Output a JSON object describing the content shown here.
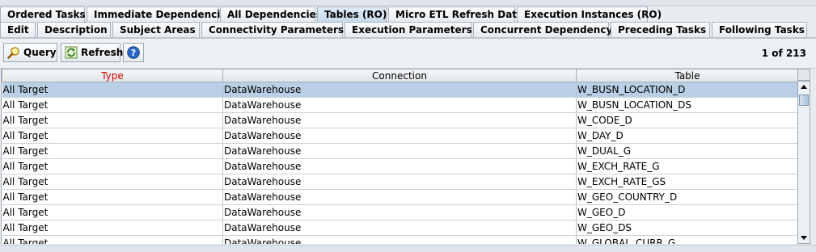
{
  "tabs_row1": [
    {
      "label": "Ordered Tasks",
      "active": false
    },
    {
      "label": "Immediate Dependencies",
      "active": false
    },
    {
      "label": "All Dependencies",
      "active": false
    },
    {
      "label": "Tables (RO)",
      "active": true
    },
    {
      "label": "Micro ETL Refresh Dates",
      "active": false
    },
    {
      "label": "Execution Instances (RO)",
      "active": false
    }
  ],
  "tabs_row2": [
    {
      "label": "Edit"
    },
    {
      "label": "Description"
    },
    {
      "label": "Subject Areas"
    },
    {
      "label": "Connectivity Parameters"
    },
    {
      "label": "Execution Parameters"
    },
    {
      "label": "Concurrent Dependency"
    },
    {
      "label": "Preceding Tasks"
    },
    {
      "label": "Following Tasks"
    }
  ],
  "toolbar": {
    "query_label": "Query",
    "refresh_label": "Refresh",
    "help_icon": "help-icon",
    "pager": "1 of 213"
  },
  "colors": {
    "selected_row": "#b8cfe5",
    "type_header": "#d40000",
    "active_tab": "#c8daee"
  },
  "table": {
    "columns": [
      "Type",
      "Connection",
      "Table"
    ],
    "rows": [
      [
        "All Target",
        "DataWarehouse",
        "W_BUSN_LOCATION_D"
      ],
      [
        "All Target",
        "DataWarehouse",
        "W_BUSN_LOCATION_DS"
      ],
      [
        "All Target",
        "DataWarehouse",
        "W_CODE_D"
      ],
      [
        "All Target",
        "DataWarehouse",
        "W_DAY_D"
      ],
      [
        "All Target",
        "DataWarehouse",
        "W_DUAL_G"
      ],
      [
        "All Target",
        "DataWarehouse",
        "W_EXCH_RATE_G"
      ],
      [
        "All Target",
        "DataWarehouse",
        "W_EXCH_RATE_GS"
      ],
      [
        "All Target",
        "DataWarehouse",
        "W_GEO_COUNTRY_D"
      ],
      [
        "All Target",
        "DataWarehouse",
        "W_GEO_D"
      ],
      [
        "All Target",
        "DataWarehouse",
        "W_GEO_DS"
      ],
      [
        "All Target",
        "DataWarehouse",
        "W_GLOBAL_CURR_G"
      ]
    ],
    "selected_row": 0
  }
}
